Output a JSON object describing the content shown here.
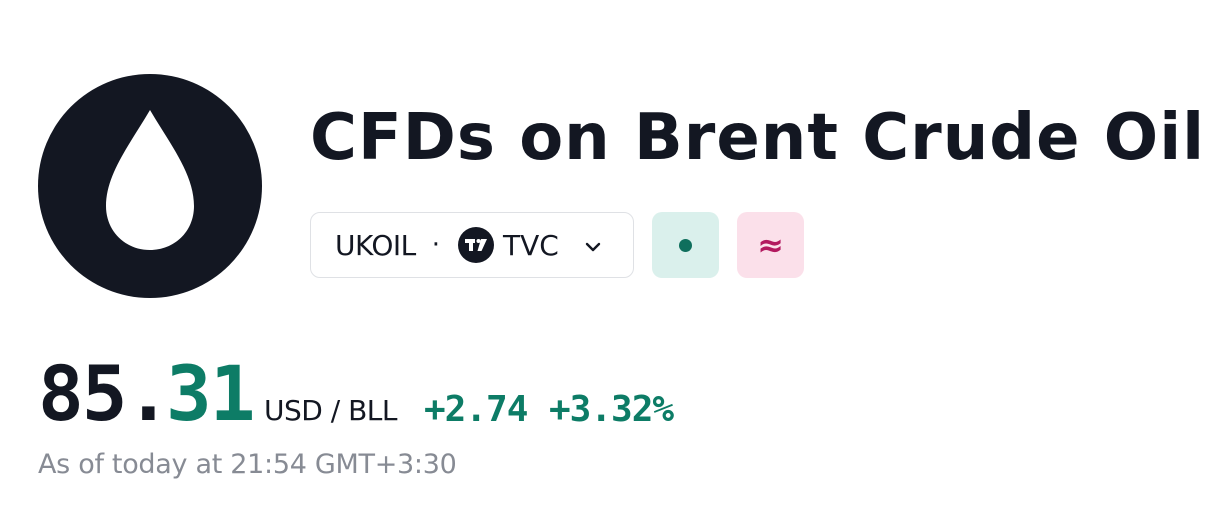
{
  "logo": {
    "icon": "oil-drop-icon"
  },
  "title": "CFDs on Brent Crude Oil",
  "symbol": {
    "ticker": "UKOIL",
    "separator": "·",
    "exchange_icon": "tradingview-logo-icon",
    "exchange": "TVC",
    "dropdown_icon": "chevron-down-icon"
  },
  "badges": {
    "market_status": {
      "icon": "dot-icon",
      "color": "#0f6f5d",
      "background": "#daf0ec"
    },
    "data_delay": {
      "symbol": "≈",
      "color": "#b3195f",
      "background": "#fbe0ea"
    }
  },
  "quote": {
    "price_integer": "85.",
    "price_decimal": "31",
    "currency": "USD / BLL",
    "change_abs": "+2.74",
    "change_pct": "+3.32%",
    "as_of": "As of today at 21:54 GMT+3:30",
    "positive_color": "#0d7c66"
  }
}
